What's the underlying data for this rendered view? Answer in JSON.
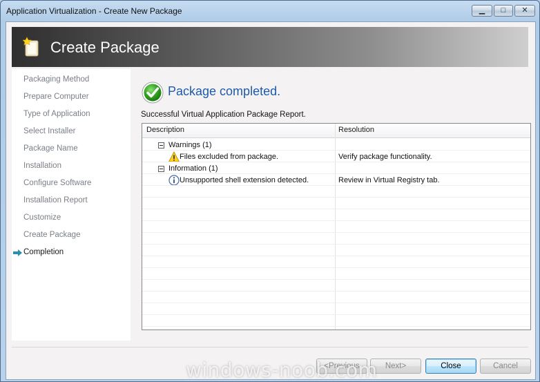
{
  "window": {
    "title": "Application Virtualization - Create New Package"
  },
  "banner": {
    "title": "Create Package"
  },
  "nav": {
    "items": [
      {
        "label": "Packaging Method",
        "active": false
      },
      {
        "label": "Prepare Computer",
        "active": false
      },
      {
        "label": "Type of Application",
        "active": false
      },
      {
        "label": "Select Installer",
        "active": false
      },
      {
        "label": "Package Name",
        "active": false
      },
      {
        "label": "Installation",
        "active": false
      },
      {
        "label": "Configure Software",
        "active": false
      },
      {
        "label": "Installation Report",
        "active": false
      },
      {
        "label": "Customize",
        "active": false
      },
      {
        "label": "Create Package",
        "active": false
      },
      {
        "label": "Completion",
        "active": true
      }
    ]
  },
  "main": {
    "title": "Package completed.",
    "report_caption": "Successful Virtual Application Package Report."
  },
  "report": {
    "columns": [
      "Description",
      "Resolution"
    ],
    "groups": [
      {
        "label": "Warnings (1)",
        "items": [
          {
            "icon": "warning-icon",
            "description": "Files excluded from package.",
            "resolution": "Verify package functionality."
          }
        ]
      },
      {
        "label": "Information (1)",
        "items": [
          {
            "icon": "info-icon",
            "description": "Unsupported shell extension detected.",
            "resolution": "Review in Virtual Registry tab."
          }
        ]
      }
    ]
  },
  "buttons": {
    "previous": "<Previous",
    "next": "Next>",
    "close": "Close",
    "cancel": "Cancel"
  },
  "watermark": "windows-noob.com",
  "colors": {
    "title_blue": "#1e5aa8",
    "nav_inactive": "#7a7f86",
    "primary_button_border": "#3c7fb1"
  }
}
